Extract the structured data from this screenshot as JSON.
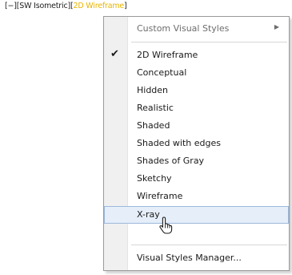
{
  "viewport_label": {
    "parts": [
      "[−][SW Isometric][",
      "2D Wireframe",
      "]"
    ]
  },
  "menu": {
    "items": [
      {
        "label": "Custom Visual Styles",
        "has_submenu": true,
        "disabled": true
      },
      {
        "label": "2D Wireframe",
        "checked": true
      },
      {
        "label": "Conceptual"
      },
      {
        "label": "Hidden"
      },
      {
        "label": "Realistic"
      },
      {
        "label": "Shaded"
      },
      {
        "label": "Shaded with edges"
      },
      {
        "label": "Shades of Gray"
      },
      {
        "label": "Sketchy"
      },
      {
        "label": "Wireframe"
      },
      {
        "label": "X-ray",
        "highlighted": true
      },
      {
        "label": "Visual Styles Manager..."
      }
    ],
    "check_glyph": "✔",
    "submenu_glyph": "▶"
  },
  "colors": {
    "active_style": "#e8b400",
    "highlight_bg": "#e5eef9",
    "highlight_border": "#9db8dc"
  }
}
